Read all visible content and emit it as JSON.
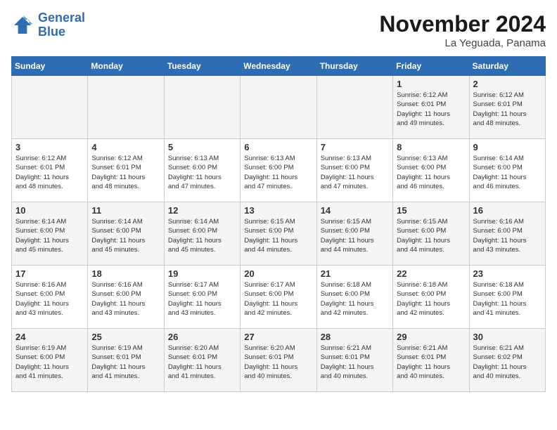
{
  "logo": {
    "line1": "General",
    "line2": "Blue"
  },
  "title": "November 2024",
  "subtitle": "La Yeguada, Panama",
  "days_of_week": [
    "Sunday",
    "Monday",
    "Tuesday",
    "Wednesday",
    "Thursday",
    "Friday",
    "Saturday"
  ],
  "weeks": [
    [
      {
        "day": "",
        "info": ""
      },
      {
        "day": "",
        "info": ""
      },
      {
        "day": "",
        "info": ""
      },
      {
        "day": "",
        "info": ""
      },
      {
        "day": "",
        "info": ""
      },
      {
        "day": "1",
        "info": "Sunrise: 6:12 AM\nSunset: 6:01 PM\nDaylight: 11 hours\nand 49 minutes."
      },
      {
        "day": "2",
        "info": "Sunrise: 6:12 AM\nSunset: 6:01 PM\nDaylight: 11 hours\nand 48 minutes."
      }
    ],
    [
      {
        "day": "3",
        "info": "Sunrise: 6:12 AM\nSunset: 6:01 PM\nDaylight: 11 hours\nand 48 minutes."
      },
      {
        "day": "4",
        "info": "Sunrise: 6:12 AM\nSunset: 6:01 PM\nDaylight: 11 hours\nand 48 minutes."
      },
      {
        "day": "5",
        "info": "Sunrise: 6:13 AM\nSunset: 6:00 PM\nDaylight: 11 hours\nand 47 minutes."
      },
      {
        "day": "6",
        "info": "Sunrise: 6:13 AM\nSunset: 6:00 PM\nDaylight: 11 hours\nand 47 minutes."
      },
      {
        "day": "7",
        "info": "Sunrise: 6:13 AM\nSunset: 6:00 PM\nDaylight: 11 hours\nand 47 minutes."
      },
      {
        "day": "8",
        "info": "Sunrise: 6:13 AM\nSunset: 6:00 PM\nDaylight: 11 hours\nand 46 minutes."
      },
      {
        "day": "9",
        "info": "Sunrise: 6:14 AM\nSunset: 6:00 PM\nDaylight: 11 hours\nand 46 minutes."
      }
    ],
    [
      {
        "day": "10",
        "info": "Sunrise: 6:14 AM\nSunset: 6:00 PM\nDaylight: 11 hours\nand 45 minutes."
      },
      {
        "day": "11",
        "info": "Sunrise: 6:14 AM\nSunset: 6:00 PM\nDaylight: 11 hours\nand 45 minutes."
      },
      {
        "day": "12",
        "info": "Sunrise: 6:14 AM\nSunset: 6:00 PM\nDaylight: 11 hours\nand 45 minutes."
      },
      {
        "day": "13",
        "info": "Sunrise: 6:15 AM\nSunset: 6:00 PM\nDaylight: 11 hours\nand 44 minutes."
      },
      {
        "day": "14",
        "info": "Sunrise: 6:15 AM\nSunset: 6:00 PM\nDaylight: 11 hours\nand 44 minutes."
      },
      {
        "day": "15",
        "info": "Sunrise: 6:15 AM\nSunset: 6:00 PM\nDaylight: 11 hours\nand 44 minutes."
      },
      {
        "day": "16",
        "info": "Sunrise: 6:16 AM\nSunset: 6:00 PM\nDaylight: 11 hours\nand 43 minutes."
      }
    ],
    [
      {
        "day": "17",
        "info": "Sunrise: 6:16 AM\nSunset: 6:00 PM\nDaylight: 11 hours\nand 43 minutes."
      },
      {
        "day": "18",
        "info": "Sunrise: 6:16 AM\nSunset: 6:00 PM\nDaylight: 11 hours\nand 43 minutes."
      },
      {
        "day": "19",
        "info": "Sunrise: 6:17 AM\nSunset: 6:00 PM\nDaylight: 11 hours\nand 43 minutes."
      },
      {
        "day": "20",
        "info": "Sunrise: 6:17 AM\nSunset: 6:00 PM\nDaylight: 11 hours\nand 42 minutes."
      },
      {
        "day": "21",
        "info": "Sunrise: 6:18 AM\nSunset: 6:00 PM\nDaylight: 11 hours\nand 42 minutes."
      },
      {
        "day": "22",
        "info": "Sunrise: 6:18 AM\nSunset: 6:00 PM\nDaylight: 11 hours\nand 42 minutes."
      },
      {
        "day": "23",
        "info": "Sunrise: 6:18 AM\nSunset: 6:00 PM\nDaylight: 11 hours\nand 41 minutes."
      }
    ],
    [
      {
        "day": "24",
        "info": "Sunrise: 6:19 AM\nSunset: 6:00 PM\nDaylight: 11 hours\nand 41 minutes."
      },
      {
        "day": "25",
        "info": "Sunrise: 6:19 AM\nSunset: 6:01 PM\nDaylight: 11 hours\nand 41 minutes."
      },
      {
        "day": "26",
        "info": "Sunrise: 6:20 AM\nSunset: 6:01 PM\nDaylight: 11 hours\nand 41 minutes."
      },
      {
        "day": "27",
        "info": "Sunrise: 6:20 AM\nSunset: 6:01 PM\nDaylight: 11 hours\nand 40 minutes."
      },
      {
        "day": "28",
        "info": "Sunrise: 6:21 AM\nSunset: 6:01 PM\nDaylight: 11 hours\nand 40 minutes."
      },
      {
        "day": "29",
        "info": "Sunrise: 6:21 AM\nSunset: 6:01 PM\nDaylight: 11 hours\nand 40 minutes."
      },
      {
        "day": "30",
        "info": "Sunrise: 6:21 AM\nSunset: 6:02 PM\nDaylight: 11 hours\nand 40 minutes."
      }
    ]
  ]
}
